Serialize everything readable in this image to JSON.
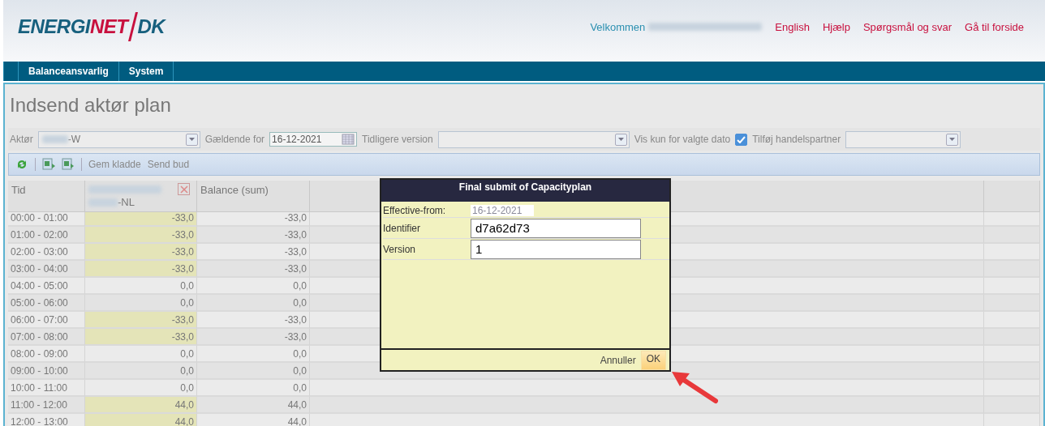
{
  "header": {
    "logo": {
      "part_1": "ENERGI",
      "part_2": "NET",
      "part_3": "DK"
    },
    "welcome": "Velkommen",
    "links": [
      "English",
      "Hjælp",
      "Spørgsmål og svar",
      "Gå til forside"
    ]
  },
  "nav": [
    {
      "label": "Balanceansvarlig"
    },
    {
      "label": "System"
    }
  ],
  "page_title": "Indsend aktør plan",
  "filters": {
    "actor_label": "Aktør",
    "actor_value": "-W",
    "valid_for_label": "Gældende for",
    "valid_for_value": "16-12-2021",
    "previous_version_label": "Tidligere version",
    "show_only_label": "Vis kun for valgte dato",
    "show_only_checked": true,
    "add_partner_label": "Tilføj handelspartner"
  },
  "toolbar": {
    "save_draft": "Gem kladde",
    "send_bid": "Send bud"
  },
  "table": {
    "columns": [
      {
        "label": "Tid"
      },
      {
        "label": "-NL"
      },
      {
        "label": "Balance (sum)"
      }
    ],
    "rows": [
      {
        "time": "00:00 - 01:00",
        "value": "-33,0",
        "balance": "-33,0",
        "highlighted": true
      },
      {
        "time": "01:00 - 02:00",
        "value": "-33,0",
        "balance": "-33,0",
        "highlighted": true
      },
      {
        "time": "02:00 - 03:00",
        "value": "-33,0",
        "balance": "-33,0",
        "highlighted": true
      },
      {
        "time": "03:00 - 04:00",
        "value": "-33,0",
        "balance": "-33,0",
        "highlighted": true
      },
      {
        "time": "04:00 - 05:00",
        "value": "0,0",
        "balance": "0,0",
        "highlighted": false
      },
      {
        "time": "05:00 - 06:00",
        "value": "0,0",
        "balance": "0,0",
        "highlighted": false
      },
      {
        "time": "06:00 - 07:00",
        "value": "-33,0",
        "balance": "-33,0",
        "highlighted": true
      },
      {
        "time": "07:00 - 08:00",
        "value": "-33,0",
        "balance": "-33,0",
        "highlighted": true
      },
      {
        "time": "08:00 - 09:00",
        "value": "0,0",
        "balance": "0,0",
        "highlighted": false
      },
      {
        "time": "09:00 - 10:00",
        "value": "0,0",
        "balance": "0,0",
        "highlighted": false
      },
      {
        "time": "10:00 - 11:00",
        "value": "0,0",
        "balance": "0,0",
        "highlighted": false
      },
      {
        "time": "11:00 - 12:00",
        "value": "44,0",
        "balance": "44,0",
        "highlighted": true
      },
      {
        "time": "12:00 - 13:00",
        "value": "44,0",
        "balance": "44,0",
        "highlighted": true
      }
    ]
  },
  "dialog": {
    "title": "Final submit of Capacityplan",
    "fields": [
      {
        "label": "Effective-from:",
        "value": "16-12-2021",
        "kind": "readonly"
      },
      {
        "label": "Identifier",
        "value": "d7a62d73",
        "kind": "input"
      },
      {
        "label": "Version",
        "value": "1",
        "kind": "input"
      }
    ],
    "cancel": "Annuller",
    "ok": "OK"
  }
}
